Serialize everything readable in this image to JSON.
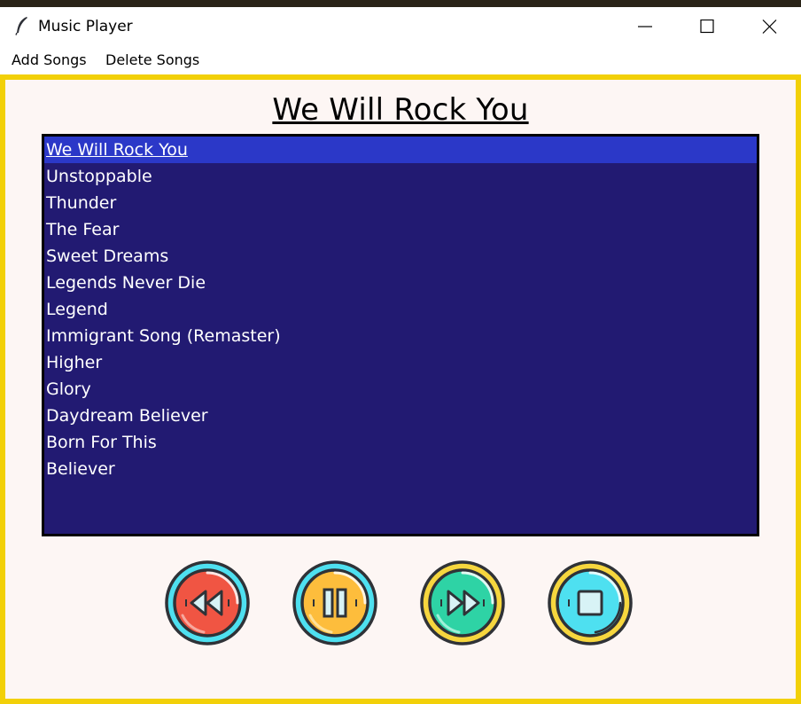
{
  "window": {
    "title": "Music Player"
  },
  "menu": {
    "add_songs": "Add Songs",
    "delete_songs": "Delete Songs"
  },
  "now_playing": {
    "title": "We Will Rock You"
  },
  "playlist": {
    "selected_index": 0,
    "songs": [
      "We Will Rock You",
      "Unstoppable",
      "Thunder",
      "The Fear",
      "Sweet Dreams",
      "Legends Never Die",
      "Legend",
      "Immigrant Song (Remaster)",
      "Higher",
      "Glory",
      "Daydream Believer",
      "Born For This",
      "Believer"
    ]
  },
  "controls": [
    {
      "name": "rewind-button",
      "icon": "rewind-icon",
      "color": "#f05543"
    },
    {
      "name": "pause-button",
      "icon": "pause-icon",
      "color": "#fdbd3c"
    },
    {
      "name": "forward-button",
      "icon": "fast-forward-icon",
      "color": "#2ed3a5"
    },
    {
      "name": "stop-button",
      "icon": "stop-icon",
      "color": "#4ee0f0"
    }
  ],
  "colors": {
    "accent_border": "#f2d008",
    "playlist_bg": "#221a72",
    "selection_bg": "#2b38c8",
    "content_bg": "#fdf6f4"
  }
}
